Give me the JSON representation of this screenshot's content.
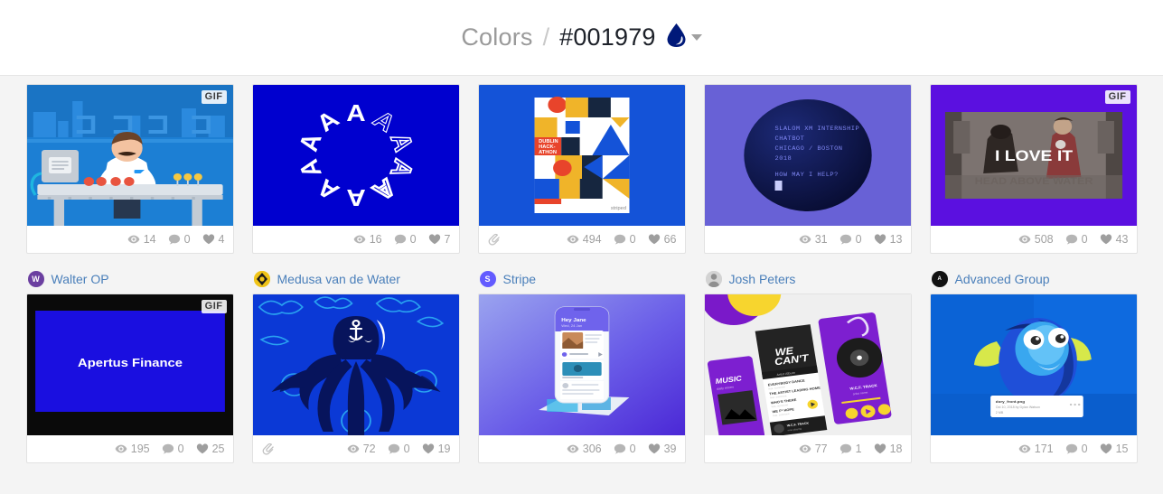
{
  "header": {
    "root_label": "Colors",
    "separator": "/",
    "current_label": "#001979",
    "swatch_color": "#001979",
    "droplet_icon": "droplet-icon",
    "caret_icon": "chevron-down-icon"
  },
  "icons": {
    "views": "eye-icon",
    "comments": "comment-bubble-icon",
    "likes": "heart-icon",
    "attachment": "paperclip-icon",
    "gif": "GIF"
  },
  "cards": [
    {
      "id": "card-1",
      "art": "factory-worker-illustration",
      "badge": "GIF",
      "has_attachment": false,
      "views": "14",
      "comments": "0",
      "likes": "4",
      "author": "Walter OP",
      "avatar_letter": "W",
      "avatar_color": "#6b3fa0"
    },
    {
      "id": "card-2",
      "art": "letter-a-circle",
      "badge": null,
      "has_attachment": false,
      "views": "16",
      "comments": "0",
      "likes": "7",
      "author": "Medusa van de Water",
      "avatar_letter": "",
      "avatar_color": "#f0c419"
    },
    {
      "id": "card-3",
      "art": "dublin-hackathon-poster",
      "badge": null,
      "has_attachment": true,
      "views": "494",
      "comments": "0",
      "likes": "66",
      "author": "Stripe",
      "avatar_letter": "S",
      "avatar_color": "#635bff"
    },
    {
      "id": "card-4",
      "art": "chatbot-terminal-circle",
      "badge": null,
      "has_attachment": false,
      "views": "31",
      "comments": "0",
      "likes": "13",
      "author": "Josh Peters",
      "avatar_letter": "",
      "avatar_color": "#b3b3b3"
    },
    {
      "id": "card-5",
      "art": "i-love-it-gif",
      "badge": "GIF",
      "has_attachment": false,
      "views": "508",
      "comments": "0",
      "likes": "43",
      "author": "Advanced Group",
      "avatar_letter": "A",
      "avatar_color": "#111111"
    },
    {
      "id": "card-6",
      "art": "apertus-finance-slate",
      "badge": "GIF",
      "has_attachment": false,
      "views": "195",
      "comments": "0",
      "likes": "25",
      "author": "",
      "avatar_letter": "",
      "avatar_color": ""
    },
    {
      "id": "card-7",
      "art": "octopus-anchor-illustration",
      "badge": null,
      "has_attachment": true,
      "views": "72",
      "comments": "0",
      "likes": "19",
      "author": "",
      "avatar_letter": "",
      "avatar_color": ""
    },
    {
      "id": "card-8",
      "art": "phone-mockup-purple",
      "badge": null,
      "has_attachment": false,
      "views": "306",
      "comments": "0",
      "likes": "39",
      "author": "",
      "avatar_letter": "",
      "avatar_color": ""
    },
    {
      "id": "card-9",
      "art": "music-app-screens-purple",
      "badge": null,
      "has_attachment": false,
      "views": "77",
      "comments": "1",
      "likes": "18",
      "author": "",
      "avatar_letter": "",
      "avatar_color": ""
    },
    {
      "id": "card-10",
      "art": "dory-fish-file-card",
      "badge": null,
      "has_attachment": false,
      "views": "171",
      "comments": "0",
      "likes": "15",
      "author": "",
      "avatar_letter": "",
      "avatar_color": ""
    }
  ],
  "artwork_text": {
    "apertus_finance": "Apertus Finance",
    "i_love_it": "I LOVE IT",
    "chatbot_lines": [
      "SLALOM XM INTERNSHIP",
      "CHATBOT",
      "CHICAGO / BOSTON",
      "2018",
      "HOW MAY I HELP?"
    ],
    "poster_title": "DUBLIN HACK- ATHON",
    "music_label": "MUSIC",
    "letter_a": "A",
    "dory_filename": "dory_front.png"
  }
}
